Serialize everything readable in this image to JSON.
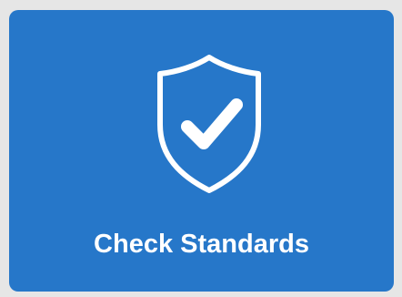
{
  "tile": {
    "label": "Check Standards",
    "icon": "shield-check-icon",
    "background_color": "#2677c9",
    "text_color": "#ffffff",
    "page_background": "#e6e6e6"
  }
}
